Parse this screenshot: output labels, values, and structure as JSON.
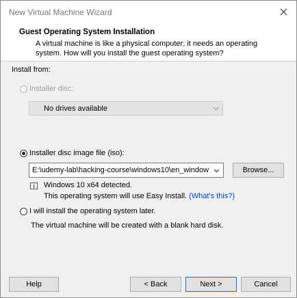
{
  "window": {
    "title": "New Virtual Machine Wizard"
  },
  "header": {
    "title": "Guest Operating System Installation",
    "description_line1": "A virtual machine is like a physical computer; it needs an operating",
    "description_line2": "system. How will you install the guest operating system?"
  },
  "install_from": {
    "label": "Install from:",
    "installer_disc": {
      "label": "Installer disc:",
      "selected": false,
      "enabled": false,
      "combo_value": "No drives available"
    },
    "iso": {
      "label": "Installer disc image file (iso):",
      "selected": true,
      "path": "E:\\udemy-lab\\hacking-course\\windows10\\en_windows",
      "browse_label": "Browse...",
      "detected": "Windows 10 x64 detected.",
      "easy_install_text": "This operating system will use Easy Install.",
      "whats_this": "(What's this?)"
    },
    "later": {
      "label": "I will install the operating system later.",
      "selected": false,
      "description": "The virtual machine will be created with a blank hard disk."
    }
  },
  "footer": {
    "help": "Help",
    "back": "< Back",
    "next": "Next >",
    "cancel": "Cancel"
  },
  "icons": [
    "close-icon",
    "dropdown-arrow-icon",
    "info-icon"
  ]
}
